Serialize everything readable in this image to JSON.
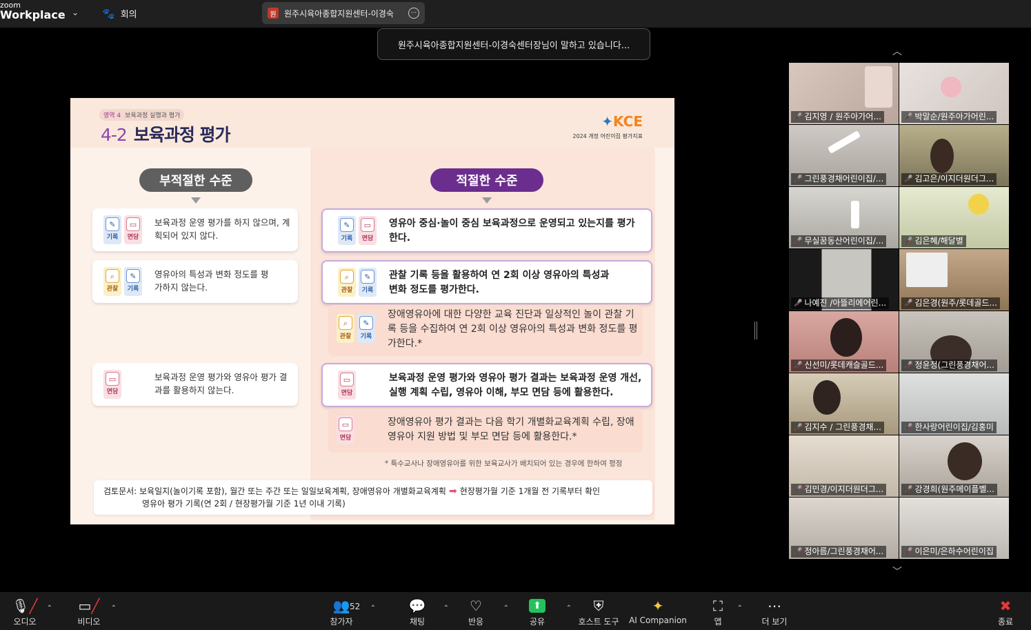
{
  "app": {
    "brand_top": "zoom",
    "brand_bottom": "Workplace",
    "meeting_label": "회의"
  },
  "speaker_chip": {
    "avatar": "원",
    "name": "원주시육아종합지원센터-이경숙"
  },
  "toast": "원주시육아종합지원센터-이경숙센터장님이 말하고 있습니다...",
  "slide": {
    "area_tag": "영역 4",
    "area_title": "보육과정 실행과 평가",
    "number": "4-2",
    "title": "보육과정 평가",
    "logo": "KCE",
    "logo_sub": "2024 개정 어린이집 평가지표",
    "bad_label": "부적절한 수준",
    "good_label": "적절한 수준",
    "bad_items": [
      {
        "text": "보육과정 운영 평가를 하지 않으며, 계획되어 있지 않다.",
        "icons": [
          "기록",
          "면담"
        ]
      },
      {
        "text": "영유아의 특성과 변화 정도를 평가하지 않는다.",
        "icons": [
          "관찰",
          "기록"
        ]
      },
      {
        "text": "보육과정 운영 평가와 영유아 평가 결과를 활용하지 않는다.",
        "icons": [
          "면담"
        ]
      }
    ],
    "good_items": [
      {
        "text": "영유아 중심·놀이 중심 보육과정으로 운영되고 있는지를 평가한다.",
        "icons": [
          "기록",
          "면담"
        ]
      },
      {
        "text": "관찰 기록 등을 활용하여 연 2회 이상 영유아의 특성과 변화 정도를 평가한다.",
        "icons": [
          "관찰",
          "기록"
        ]
      },
      {
        "text": "장애영유아에 대한 다양한 교육 진단과 일상적인 놀이 관찰 기록 등을 수집하여 연 2회 이상 영유아의 특성과 변화 정도를 평가한다.*",
        "icons": [
          "관찰",
          "기록"
        ]
      },
      {
        "text": "보육과정 운영 평가와 영유아 평가 결과는 보육과정 운영 개선, 실행 계획 수립, 영유아 이해, 부모 면담 등에 활용한다.",
        "icons": [
          "면담"
        ]
      },
      {
        "text": "장애영유아 평가 결과는 다음 학기 개별화교육계획 수립, 장애영유아 지원 방법 및 부모 면담 등에 활용한다.*",
        "icons": [
          "면담"
        ]
      }
    ],
    "note": "* 특수교사나 장애영유아를 위한 보육교사가 배치되어 있는 경우에 한하여 평정",
    "doc_line1": "검토문서: 보육일지(놀이기록 포함), 월간 또는 주간 또는 일일보육계획, 장애영유아 개별화교육계획",
    "doc_arrow_text": "현장평가월 기준 1개월 전 기록부터 확인",
    "doc_line2": "영유아 평가 기록(연 2회 / 현장평가월 기준 1년 이내 기록)"
  },
  "participants": [
    "김지영 / 원주아가어...",
    "박말순/원주아가어린...",
    "그린풍경채어린이집/...",
    "김고은/이지더원더그...",
    "무실꿈동산어린이집/...",
    "김은혜/해달별",
    "나예진 /아뜰리에어린...",
    "김은경(원주/롯데골드...",
    "신선미/롯데캐슬골드...",
    "정윤정(그린풍경채어...",
    "김지수 / 그린풍경채...",
    "한사랑어린이집/김홍미",
    "김민경/이지더원더그...",
    "강경희(원주메이플벨...",
    "정아름/그린풍경채어...",
    "이은미/은하수어린이집"
  ],
  "toolbar": {
    "audio": "오디오",
    "video": "비디오",
    "participants": "참가자",
    "participants_count": "52",
    "chat": "채팅",
    "reactions": "반응",
    "share": "공유",
    "host_tools": "호스트 도구",
    "ai": "AI Companion",
    "apps": "앱",
    "more": "더 보기",
    "end": "종료"
  },
  "colors": {
    "accent_purple": "#6b2d8e",
    "share_green": "#23c35c",
    "end_red": "#e53935"
  }
}
